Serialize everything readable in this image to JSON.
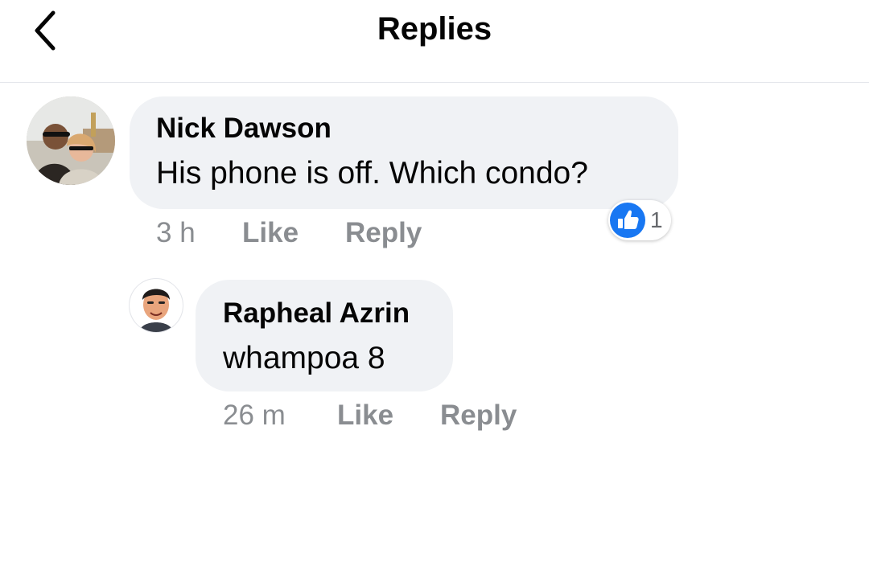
{
  "header": {
    "title": "Replies",
    "back_icon": "chevron-left-icon"
  },
  "comments": [
    {
      "author": "Nick Dawson",
      "text": "His phone is off. Which condo?",
      "time": "3 h",
      "like_label": "Like",
      "reply_label": "Reply",
      "reaction": {
        "icon": "thumbs-up-icon",
        "count": "1",
        "color": "#1877f2"
      }
    },
    {
      "author": "Rapheal Azrin",
      "text": "whampoa 8",
      "time": "26 m",
      "like_label": "Like",
      "reply_label": "Reply"
    }
  ],
  "colors": {
    "bubble": "#f0f2f5",
    "meta": "#8a8d91",
    "accent": "#1877f2"
  }
}
